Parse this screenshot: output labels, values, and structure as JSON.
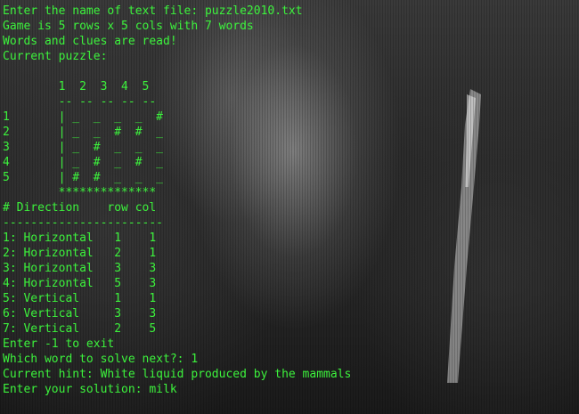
{
  "terminal": {
    "lines": [
      "Enter the name of text file: puzzle2010.txt",
      "Game is 5 rows x 5 cols with 7 words",
      "Words and clues are read!",
      "Current puzzle:",
      "",
      "        1  2  3  4  5",
      "        -- -- -- -- --",
      "1       | _  _  _  _  #",
      "2       | _  _  #  #  _",
      "3       | _  #  _  _  _",
      "4       | _  #  _  #  _",
      "5       | #  #  _  _  _",
      "        **************",
      "# Direction    row col",
      "-----------------------",
      "1: Horizontal   1    1",
      "2: Horizontal   2    1",
      "3: Horizontal   3    3",
      "4: Horizontal   5    3",
      "5: Vertical     1    1",
      "6: Vertical     3    3",
      "7: Vertical     2    5",
      "Enter -1 to exit",
      "Which word to solve next?: 1",
      "Current hint: White liquid produced by the mammals",
      "Enter your solution: milk"
    ]
  },
  "colors": {
    "text": "#3cf23c",
    "background": "#1c1c1c"
  }
}
